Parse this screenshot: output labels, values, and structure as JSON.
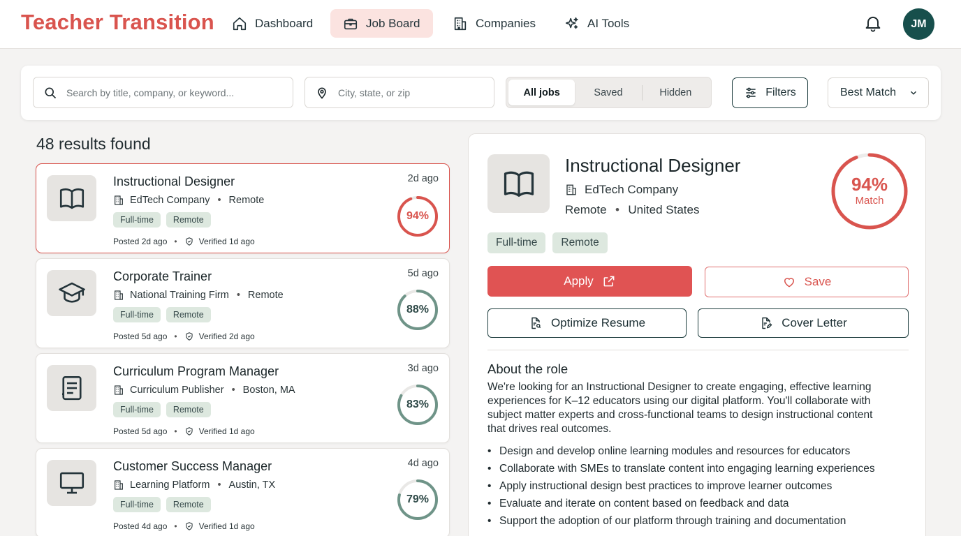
{
  "brand": "Teacher Transition",
  "nav": {
    "dashboard": "Dashboard",
    "job_board": "Job Board",
    "companies": "Companies",
    "ai_tools": "AI Tools"
  },
  "user": {
    "initials": "JM"
  },
  "search": {
    "keyword_placeholder": "Search by title, company, or keyword...",
    "location_placeholder": "City, state, or zip",
    "tabs": {
      "all": "All jobs",
      "saved": "Saved",
      "hidden": "Hidden"
    },
    "filters_label": "Filters",
    "sort_label": "Best Match"
  },
  "results": {
    "count_text": "48 results found",
    "jobs": [
      {
        "title": "Instructional Designer",
        "company": "EdTech Company",
        "location": "Remote",
        "tags": [
          "Full-time",
          "Remote"
        ],
        "posted": "Posted 2d ago",
        "verified": "Verified 1d ago",
        "age": "2d ago",
        "match": 94,
        "match_text": "94%",
        "icon": "book-icon"
      },
      {
        "title": "Corporate Trainer",
        "company": "National Training Firm",
        "location": "Remote",
        "tags": [
          "Full-time",
          "Remote"
        ],
        "posted": "Posted 5d ago",
        "verified": "Verified 2d ago",
        "age": "5d ago",
        "match": 88,
        "match_text": "88%",
        "icon": "graduation-cap-icon"
      },
      {
        "title": "Curriculum Program Manager",
        "company": "Curriculum Publisher",
        "location": "Boston, MA",
        "tags": [
          "Full-time",
          "Remote"
        ],
        "posted": "Posted 5d ago",
        "verified": "Verified 1d ago",
        "age": "3d ago",
        "match": 83,
        "match_text": "83%",
        "icon": "notebook-icon"
      },
      {
        "title": "Customer Success Manager",
        "company": "Learning Platform",
        "location": "Austin, TX",
        "tags": [
          "Full-time",
          "Remote"
        ],
        "posted": "Posted 4d ago",
        "verified": "Verified 1d ago",
        "age": "4d ago",
        "match": 79,
        "match_text": "79%",
        "icon": "monitor-icon"
      }
    ]
  },
  "detail": {
    "title": "Instructional Designer",
    "company": "EdTech Company",
    "location": "Remote",
    "country": "United States",
    "match": 94,
    "match_pct": "94%",
    "match_label": "Match",
    "tags": [
      "Full-time",
      "Remote"
    ],
    "apply_label": "Apply",
    "save_label": "Save",
    "optimize_label": "Optimize Resume",
    "cover_label": "Cover Letter",
    "about_title": "About the role",
    "about_text": "We're looking for an Instructional Designer to create engaging, effective learning experiences for K–12 educators using our digital platform. You'll collaborate with subject matter experts and cross-functional teams to design instructional content that drives real outcomes.",
    "responsibilities": [
      "Design and develop online learning modules and resources for educators",
      "Collaborate with SMEs to translate content into engaging learning experiences",
      "Apply instructional design best practices to improve learner outcomes",
      "Evaluate and iterate on content based on feedback and data",
      "Support the adoption of our platform through training and documentation"
    ]
  },
  "colors": {
    "brand": "#d9544e",
    "accent_dark": "#174f4c",
    "match_high": "#d9544e",
    "match_normal": "#6f9488",
    "tag_bg": "#dde8df"
  }
}
